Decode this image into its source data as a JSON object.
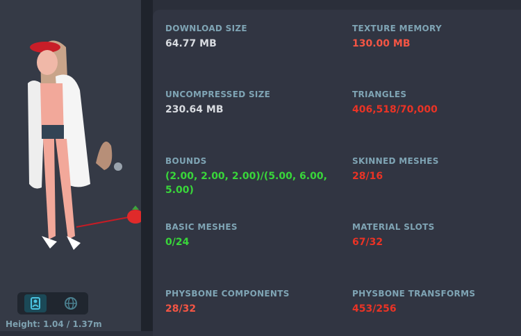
{
  "avatar": {
    "height_text": "Height: 1.04 / 1.37m"
  },
  "stats": [
    {
      "label": "DOWNLOAD SIZE",
      "value": "64.77 MB",
      "color": "#d8dbe0"
    },
    {
      "label": "TEXTURE MEMORY",
      "value": "130.00 MB",
      "color": "#f45544"
    },
    {
      "label": "UNCOMPRESSED SIZE",
      "value": "230.64 MB",
      "color": "#d8dbe0"
    },
    {
      "label": "TRIANGLES",
      "value": "406,518/70,000",
      "color": "#ea3325"
    },
    {
      "label": "BOUNDS",
      "value": "(2.00, 2.00, 2.00)/(5.00, 6.00, 5.00)",
      "color": "#39d63a"
    },
    {
      "label": "SKINNED MESHES",
      "value": "28/16",
      "color": "#ea3325"
    },
    {
      "label": "BASIC MESHES",
      "value": "0/24",
      "color": "#39d63a"
    },
    {
      "label": "MATERIAL SLOTS",
      "value": "67/32",
      "color": "#ea3325"
    },
    {
      "label": "PHYSBONE COMPONENTS",
      "value": "28/32",
      "color": "#f45544"
    },
    {
      "label": "PHYSBONE TRANSFORMS",
      "value": "453/256",
      "color": "#ea3325"
    }
  ],
  "view_toggle": {
    "options": [
      "avatar-view-icon",
      "globe-view-icon"
    ]
  }
}
